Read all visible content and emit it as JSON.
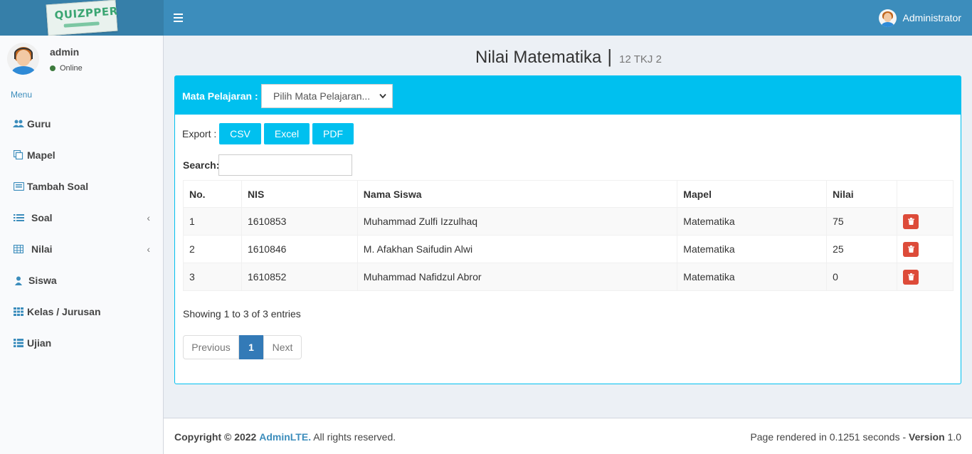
{
  "header": {
    "logo_text": "QUIZPPER",
    "user_name": "Administrator"
  },
  "sidebar": {
    "user": {
      "name": "admin",
      "status": "Online"
    },
    "menu_header": "Menu",
    "items": [
      {
        "label": "Guru",
        "icon": "users-icon",
        "has_children": false
      },
      {
        "label": "Mapel",
        "icon": "copy-icon",
        "has_children": false
      },
      {
        "label": "Tambah Soal",
        "icon": "keyboard-icon",
        "has_children": false
      },
      {
        "label": "Soal",
        "icon": "list-icon",
        "has_children": true
      },
      {
        "label": "Nilai",
        "icon": "table-icon",
        "has_children": true
      },
      {
        "label": "Siswa",
        "icon": "user-icon",
        "has_children": false
      },
      {
        "label": "Kelas / Jurusan",
        "icon": "grid-icon",
        "has_children": false
      },
      {
        "label": "Ujian",
        "icon": "th-list-icon",
        "has_children": false
      }
    ]
  },
  "page": {
    "title": "Nilai Matematika",
    "separator": "|",
    "subtitle": "12 TKJ 2"
  },
  "filter": {
    "label": "Mata Pelajaran :",
    "selected": "Pilih Mata Pelajaran..."
  },
  "export": {
    "label": "Export :",
    "buttons": [
      "CSV",
      "Excel",
      "PDF"
    ]
  },
  "search": {
    "label": "Search:",
    "value": ""
  },
  "table": {
    "columns": [
      "No.",
      "NIS",
      "Nama Siswa",
      "Mapel",
      "Nilai",
      ""
    ],
    "rows": [
      [
        "1",
        "1610853",
        "Muhammad Zulfi Izzulhaq",
        "Matematika",
        "75"
      ],
      [
        "2",
        "1610846",
        "M. Afakhan Saifudin Alwi",
        "Matematika",
        "25"
      ],
      [
        "3",
        "1610852",
        "Muhammad Nafidzul Abror",
        "Matematika",
        "0"
      ]
    ]
  },
  "pagination": {
    "info": "Showing 1 to 3 of 3 entries",
    "previous": "Previous",
    "current": "1",
    "next": "Next"
  },
  "footer": {
    "copyright": "Copyright © 2022",
    "brand": "AdminLTE.",
    "rights": "All rights reserved.",
    "render_text": "Page rendered in 0.1251 seconds - ",
    "version_label": "Version",
    "version": "1.0"
  },
  "colors": {
    "header": "#3c8dbc",
    "logo_bg": "#367fa9",
    "info": "#00c0ef",
    "danger": "#dd4b39",
    "primary": "#337ab7"
  }
}
